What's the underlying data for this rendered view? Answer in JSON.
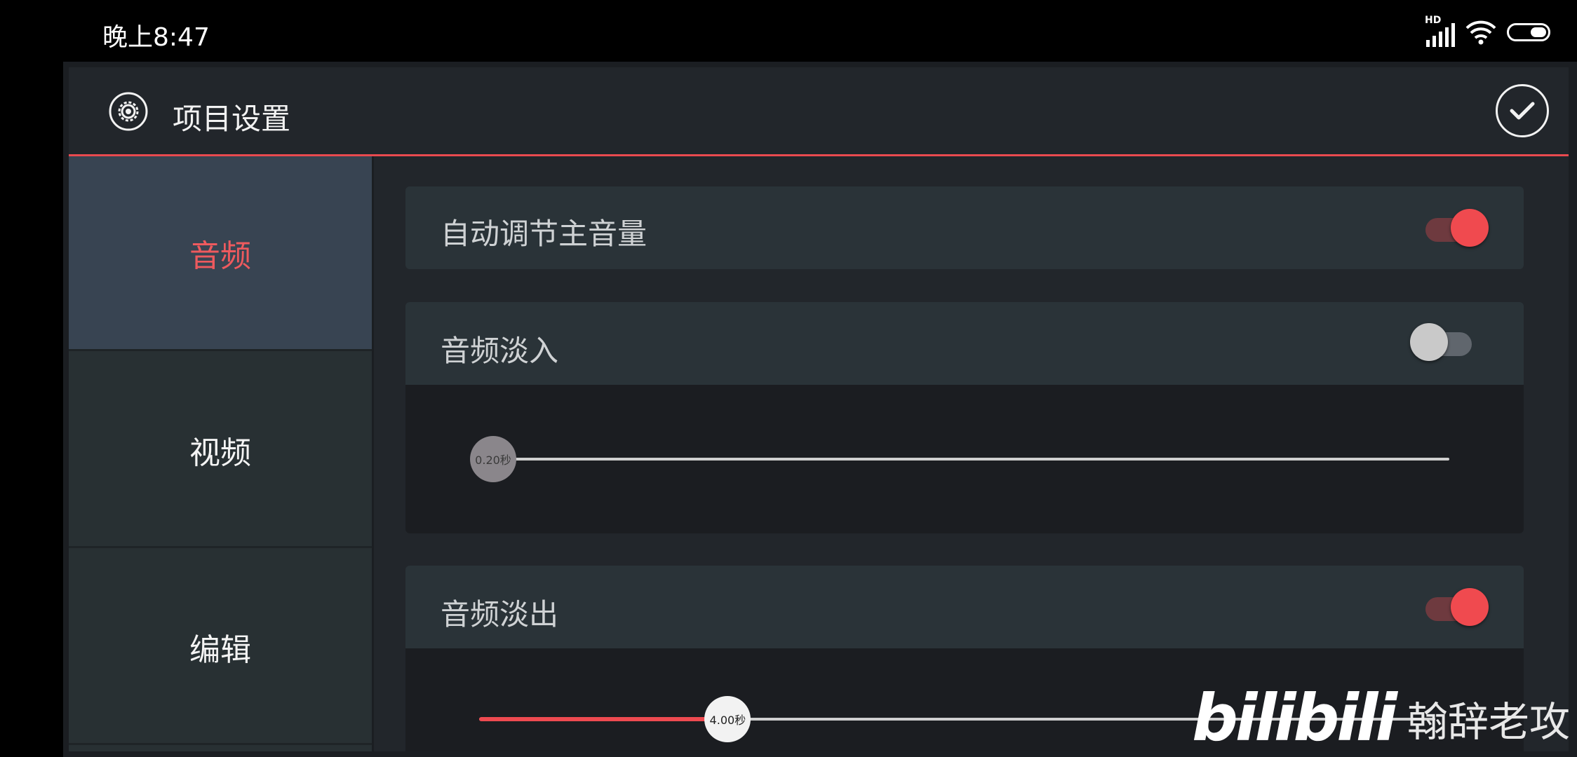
{
  "status_bar": {
    "time": "晚上8:47",
    "network_badge": "HD",
    "icons": [
      "signal-icon",
      "wifi-icon",
      "battery-icon"
    ]
  },
  "header": {
    "title": "项目设置",
    "icon": "gear-icon",
    "confirm_icon": "check-circle-icon"
  },
  "sidebar": {
    "items": [
      {
        "label": "音频",
        "active": true
      },
      {
        "label": "视频",
        "active": false
      },
      {
        "label": "编辑",
        "active": false
      }
    ]
  },
  "settings": {
    "auto_volume": {
      "label": "自动调节主音量",
      "enabled": true
    },
    "fade_in": {
      "label": "音频淡入",
      "enabled": false,
      "value": "0.20秒",
      "fraction": 0.0
    },
    "fade_out": {
      "label": "音频淡出",
      "enabled": true,
      "value": "4.00秒",
      "fraction": 0.26
    }
  },
  "watermark": {
    "logo": "bilibili",
    "author": "翰辞老攻"
  },
  "colors": {
    "accent": "#ee4a50",
    "background": "#22262b",
    "card": "#2a3338",
    "sidebar_active": "#384452"
  }
}
